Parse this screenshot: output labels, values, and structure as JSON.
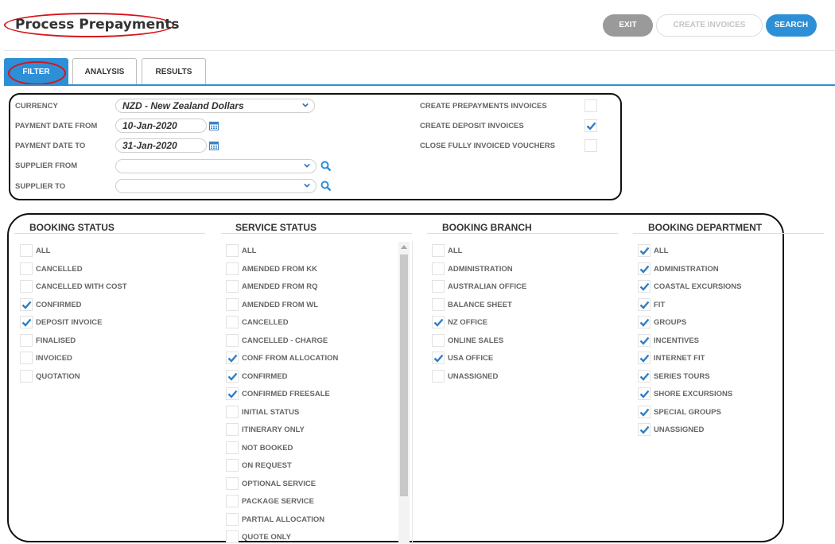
{
  "header": {
    "title": "Process Prepayments",
    "exit_label": "EXIT",
    "create_invoices_label": "CREATE INVOICES",
    "search_label": "SEARCH"
  },
  "tabs": [
    {
      "label": "FILTER",
      "active": true
    },
    {
      "label": "ANALYSIS",
      "active": false
    },
    {
      "label": "RESULTS",
      "active": false
    }
  ],
  "filter": {
    "currency_label": "CURRENCY",
    "currency_value": "NZD - New Zealand Dollars",
    "payment_date_from_label": "PAYMENT DATE FROM",
    "payment_date_from_value": "10-Jan-2020",
    "payment_date_to_label": "PAYMENT DATE TO",
    "payment_date_to_value": "31-Jan-2020",
    "supplier_from_label": "SUPPLIER FROM",
    "supplier_from_value": "",
    "supplier_to_label": "SUPPLIER TO",
    "supplier_to_value": "",
    "options": [
      {
        "label": "CREATE PREPAYMENTS INVOICES",
        "checked": false
      },
      {
        "label": "CREATE DEPOSIT INVOICES",
        "checked": true
      },
      {
        "label": "CLOSE FULLY INVOICED VOUCHERS",
        "checked": false
      }
    ]
  },
  "columns": [
    {
      "title": "BOOKING STATUS",
      "items": [
        {
          "label": "ALL",
          "checked": false
        },
        {
          "label": "CANCELLED",
          "checked": false
        },
        {
          "label": "CANCELLED WITH COST",
          "checked": false
        },
        {
          "label": "CONFIRMED",
          "checked": true
        },
        {
          "label": "DEPOSIT INVOICE",
          "checked": true
        },
        {
          "label": "FINALISED",
          "checked": false
        },
        {
          "label": "INVOICED",
          "checked": false
        },
        {
          "label": "QUOTATION",
          "checked": false
        }
      ]
    },
    {
      "title": "SERVICE STATUS",
      "items": [
        {
          "label": "ALL",
          "checked": false
        },
        {
          "label": "AMENDED FROM KK",
          "checked": false
        },
        {
          "label": "AMENDED FROM RQ",
          "checked": false
        },
        {
          "label": "AMENDED FROM WL",
          "checked": false
        },
        {
          "label": "CANCELLED",
          "checked": false
        },
        {
          "label": "CANCELLED - CHARGE",
          "checked": false
        },
        {
          "label": "CONF FROM ALLOCATION",
          "checked": true
        },
        {
          "label": "CONFIRMED",
          "checked": true
        },
        {
          "label": "CONFIRMED FREESALE",
          "checked": true
        },
        {
          "label": "INITIAL STATUS",
          "checked": false
        },
        {
          "label": "ITINERARY ONLY",
          "checked": false
        },
        {
          "label": "NOT BOOKED",
          "checked": false
        },
        {
          "label": "ON REQUEST",
          "checked": false
        },
        {
          "label": "OPTIONAL SERVICE",
          "checked": false
        },
        {
          "label": "PACKAGE SERVICE",
          "checked": false
        },
        {
          "label": "PARTIAL ALLOCATION",
          "checked": false
        },
        {
          "label": "QUOTE ONLY",
          "checked": false
        }
      ]
    },
    {
      "title": "BOOKING BRANCH",
      "items": [
        {
          "label": "ALL",
          "checked": false
        },
        {
          "label": "ADMINISTRATION",
          "checked": false
        },
        {
          "label": "AUSTRALIAN OFFICE",
          "checked": false
        },
        {
          "label": "BALANCE SHEET",
          "checked": false
        },
        {
          "label": "NZ OFFICE",
          "checked": true
        },
        {
          "label": "ONLINE SALES",
          "checked": false
        },
        {
          "label": "USA OFFICE",
          "checked": true
        },
        {
          "label": "UNASSIGNED",
          "checked": false
        }
      ]
    },
    {
      "title": "BOOKING DEPARTMENT",
      "items": [
        {
          "label": "ALL",
          "checked": true
        },
        {
          "label": "ADMINISTRATION",
          "checked": true
        },
        {
          "label": "COASTAL EXCURSIONS",
          "checked": true
        },
        {
          "label": "FIT",
          "checked": true
        },
        {
          "label": "GROUPS",
          "checked": true
        },
        {
          "label": "INCENTIVES",
          "checked": true
        },
        {
          "label": "INTERNET FIT",
          "checked": true
        },
        {
          "label": "SERIES TOURS",
          "checked": true
        },
        {
          "label": "SHORE EXCURSIONS",
          "checked": true
        },
        {
          "label": "SPECIAL GROUPS",
          "checked": true
        },
        {
          "label": "UNASSIGNED",
          "checked": true
        }
      ]
    }
  ],
  "colors": {
    "accent": "#2d8fd6",
    "annotation_red": "#d8141b",
    "exit_grey": "#9a9a9a"
  },
  "icons": {
    "check": "check-icon",
    "calendar": "calendar-icon",
    "search": "magnifier-icon",
    "dropdown": "chevron-down-icon"
  }
}
